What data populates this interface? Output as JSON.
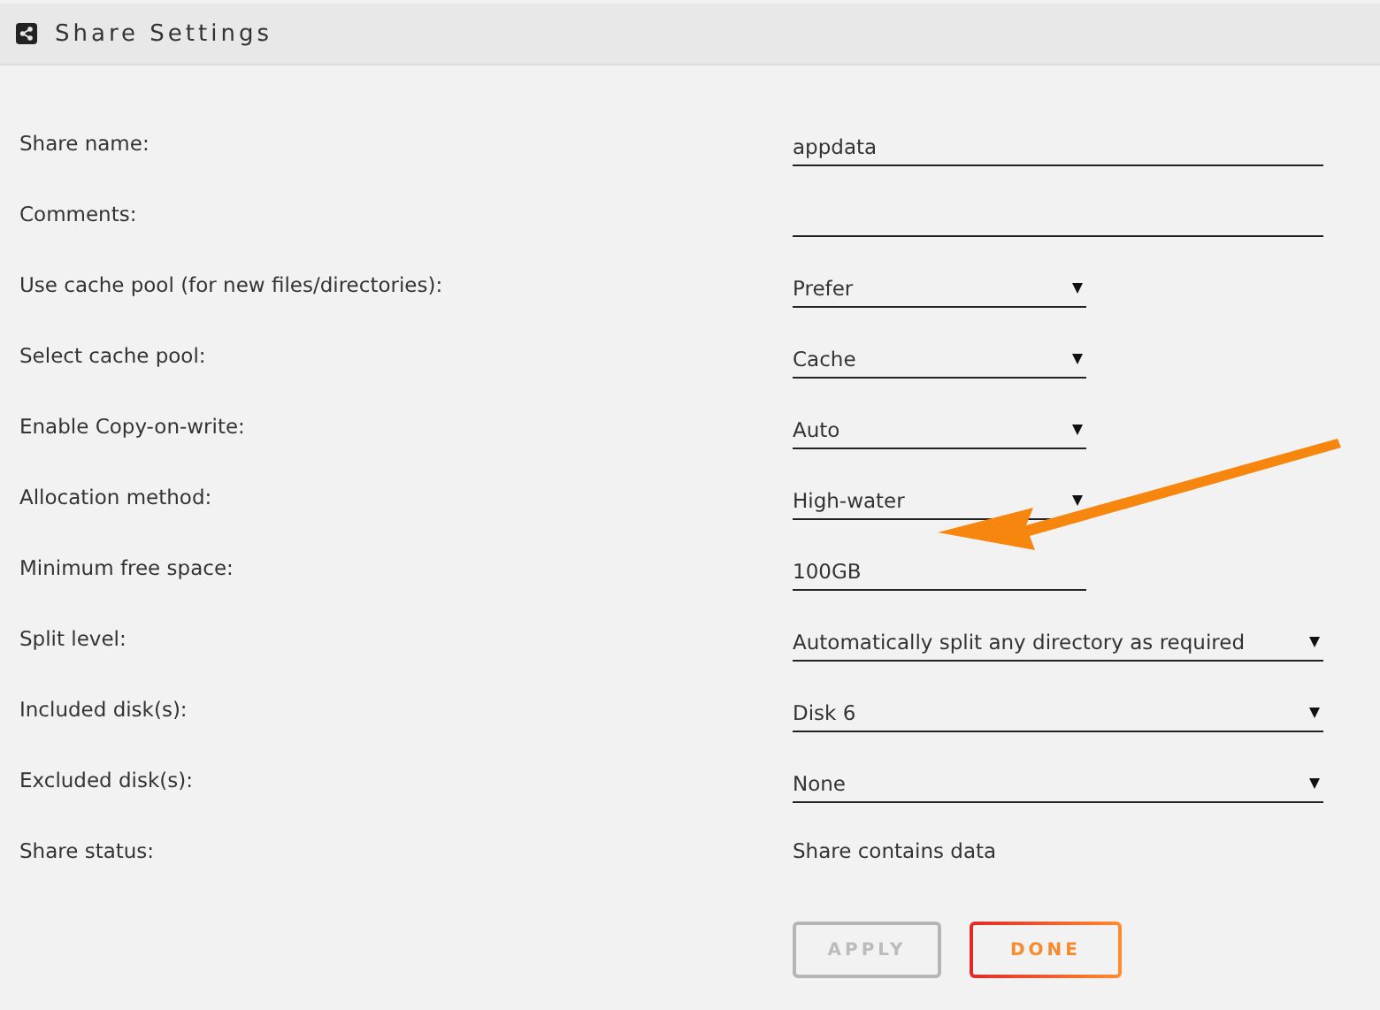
{
  "header": {
    "title": "Share Settings"
  },
  "fields": [
    {
      "label": "Share name:",
      "kind": "text",
      "value": "appdata"
    },
    {
      "label": "Comments:",
      "kind": "text"
    },
    {
      "label": "Use cache pool (for new files/directories):",
      "kind": "select",
      "value": "Prefer"
    },
    {
      "label": "Select cache pool:",
      "kind": "select",
      "value": "Cache"
    },
    {
      "label": "Enable Copy-on-write:",
      "kind": "select",
      "value": "Auto"
    },
    {
      "label": "Allocation method:",
      "kind": "select",
      "value": "High-water"
    },
    {
      "label": "Minimum free space:",
      "kind": "short",
      "value": "100GB"
    },
    {
      "label": "Split level:",
      "kind": "wideselect",
      "value": "Automatically split any directory as required"
    },
    {
      "label": "Included disk(s):",
      "kind": "wideselect",
      "value": "Disk 6"
    },
    {
      "label": "Excluded disk(s):",
      "kind": "wideselect",
      "value": "None"
    },
    {
      "label": "Share status:",
      "kind": "status",
      "value": "Share contains data"
    }
  ],
  "buttons": [
    {
      "label": "APPLY",
      "disabled": true
    },
    {
      "label": "DONE",
      "disabled": false
    }
  ]
}
